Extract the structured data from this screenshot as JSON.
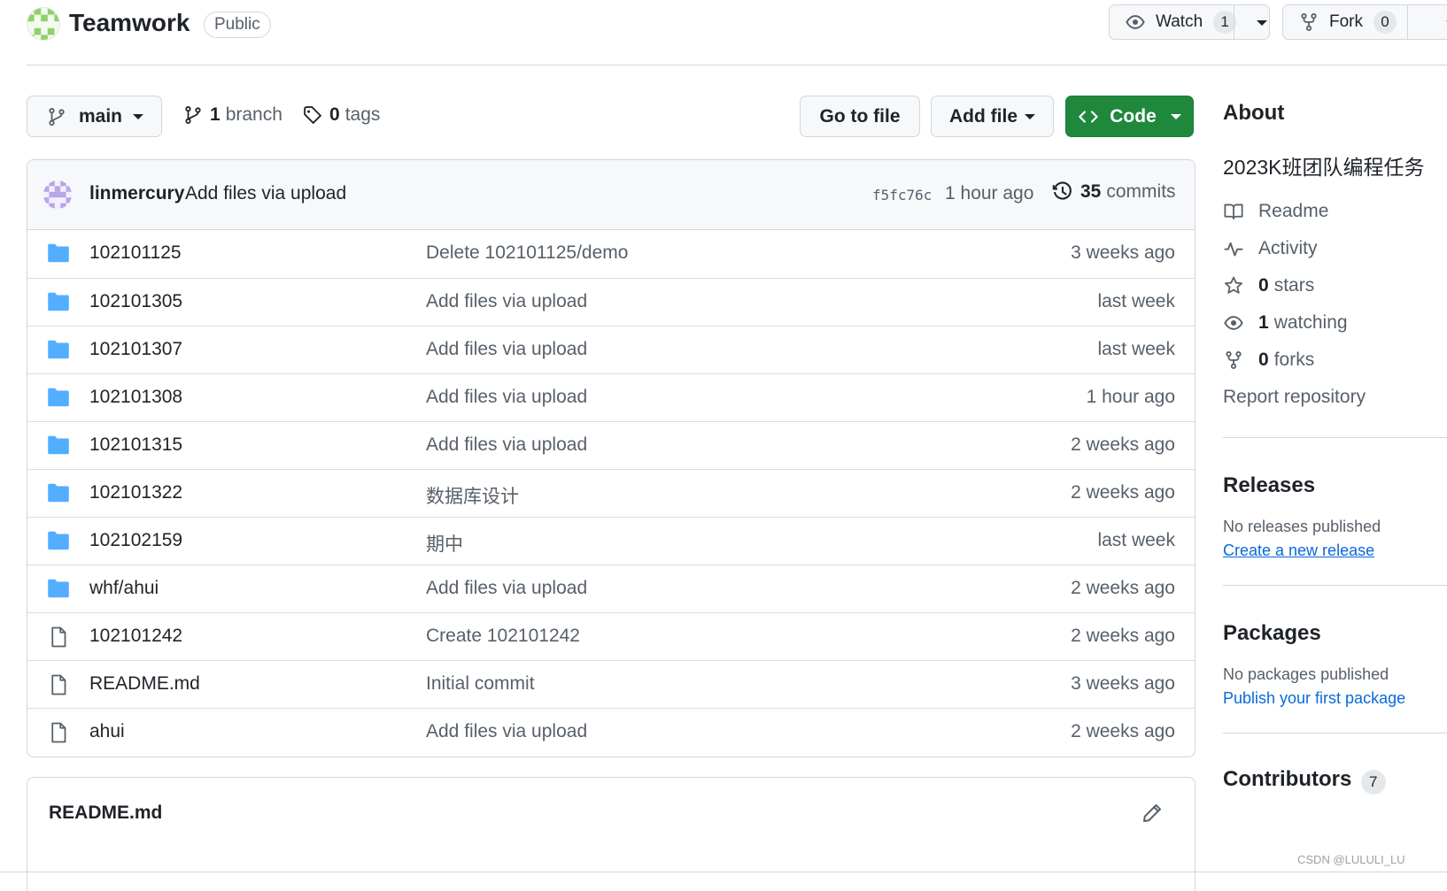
{
  "repo": {
    "name": "Teamwork",
    "visibility": "Public"
  },
  "header": {
    "watch_label": "Watch",
    "watch_count": "1",
    "fork_label": "Fork",
    "fork_count": "0"
  },
  "toolbar": {
    "branch": "main",
    "branch_count": "1",
    "branch_label": "branch",
    "tag_count": "0",
    "tag_label": "tags",
    "goto_label": "Go to file",
    "addfile_label": "Add file",
    "code_label": "Code"
  },
  "latest_commit": {
    "author": "linmercury",
    "message": "Add files via upload",
    "sha": "f5fc76c",
    "time": "1 hour ago",
    "count": "35",
    "count_label": "commits"
  },
  "files": [
    {
      "type": "dir",
      "name": "102101125",
      "message": "Delete 102101125/demo",
      "time": "3 weeks ago"
    },
    {
      "type": "dir",
      "name": "102101305",
      "message": "Add files via upload",
      "time": "last week"
    },
    {
      "type": "dir",
      "name": "102101307",
      "message": "Add files via upload",
      "time": "last week"
    },
    {
      "type": "dir",
      "name": "102101308",
      "message": "Add files via upload",
      "time": "1 hour ago"
    },
    {
      "type": "dir",
      "name": "102101315",
      "message": "Add files via upload",
      "time": "2 weeks ago"
    },
    {
      "type": "dir",
      "name": "102101322",
      "message": "数据库设计",
      "time": "2 weeks ago"
    },
    {
      "type": "dir",
      "name": "102102159",
      "message": "期中",
      "time": "last week"
    },
    {
      "type": "dir",
      "name": "whf/ahui",
      "message": "Add files via upload",
      "time": "2 weeks ago"
    },
    {
      "type": "file",
      "name": "102101242",
      "message": "Create 102101242",
      "time": "2 weeks ago"
    },
    {
      "type": "file",
      "name": "README.md",
      "message": "Initial commit",
      "time": "3 weeks ago"
    },
    {
      "type": "file",
      "name": "ahui",
      "message": "Add files via upload",
      "time": "2 weeks ago"
    }
  ],
  "readme": {
    "title": "README.md"
  },
  "about": {
    "heading": "About",
    "description": "2023K班团队编程任务",
    "readme_label": "Readme",
    "activity_label": "Activity",
    "stars_count": "0",
    "stars_label": "stars",
    "watching_count": "1",
    "watching_label": "watching",
    "forks_count": "0",
    "forks_label": "forks",
    "report_label": "Report repository"
  },
  "releases": {
    "heading": "Releases",
    "empty_text": "No releases published",
    "link": "Create a new release"
  },
  "packages": {
    "heading": "Packages",
    "empty_text": "No packages published",
    "link": "Publish your first package"
  },
  "contributors": {
    "heading": "Contributors",
    "count": "7"
  },
  "watermark": "CSDN @LULULI_LU",
  "colors": {
    "accent_green": "#1f883d",
    "link_blue": "#0969da",
    "folder_blue": "#54aeff",
    "muted_text": "#57606a"
  }
}
